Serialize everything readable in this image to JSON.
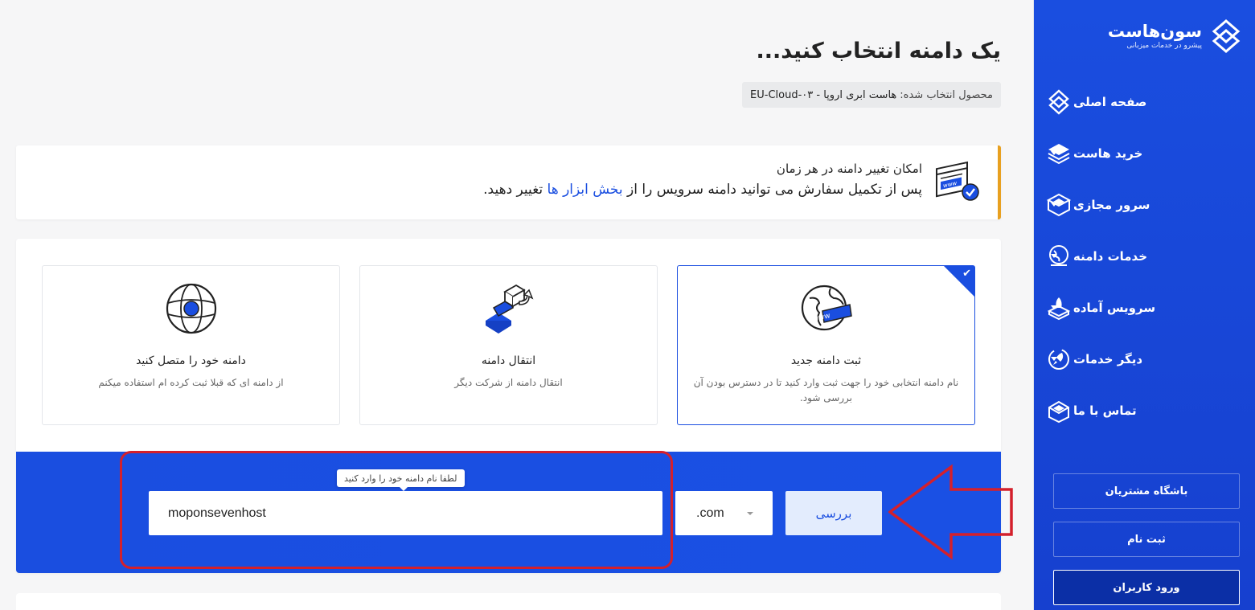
{
  "brand": {
    "name": "سون‌هاست",
    "tagline": "پیشرو در خدمات میزبانی",
    "accent": "#1a4ee0"
  },
  "sidebar": {
    "items": [
      {
        "label": "صفحه اصلی",
        "icon": "home-diamond-icon",
        "has_caret": false
      },
      {
        "label": "خرید هاست",
        "icon": "layers-icon",
        "has_caret": true
      },
      {
        "label": "سرور مجازی",
        "icon": "server-box-icon",
        "has_caret": true
      },
      {
        "label": "خدمات دامنه",
        "icon": "globe-icon",
        "has_caret": true
      },
      {
        "label": "سرویس آماده",
        "icon": "rocket-box-icon",
        "has_caret": true
      },
      {
        "label": "دیگر خدمات",
        "icon": "rocket-circle-icon",
        "has_caret": true
      },
      {
        "label": "تماس با ما",
        "icon": "envelope-box-icon",
        "has_caret": false
      }
    ],
    "buttons": {
      "client_club": "باشگاه مشتریان",
      "register": "ثبت نام",
      "login": "ورود کاربران"
    }
  },
  "main": {
    "title": "یک دامنه انتخاب کنید...",
    "selected_product_label": "محصول انتخاب شده:",
    "selected_product_value": "هاست ابری اروپا - EU-Cloud-۰۳",
    "notice": {
      "title": "امکان تغییر دامنه در هر زمان",
      "body_before": "پس از تکمیل سفارش می توانید دامنه سرویس را از",
      "link": "بخش ابزار ها",
      "body_after": "تغییر دهید.",
      "accent": "#e8a020"
    },
    "options": [
      {
        "title": "ثبت دامنه جدید",
        "desc": "نام دامنه انتخابی خود را جهت ثبت وارد کنید تا در دسترس بودن آن بررسی شود.",
        "selected": true
      },
      {
        "title": "انتقال دامنه",
        "desc": "انتقال دامنه از شرکت دیگر",
        "selected": false
      },
      {
        "title": "دامنه خود را متصل کنید",
        "desc": "از دامنه ای که قبلا ثبت کرده ام استفاده میکنم",
        "selected": false
      }
    ],
    "search": {
      "tooltip": "لطفا نام دامنه خود را وارد کنید",
      "value": "moponsevenhost",
      "tld": ".com",
      "check_label": "بررسی"
    }
  },
  "annotation_color": "#d4202c"
}
